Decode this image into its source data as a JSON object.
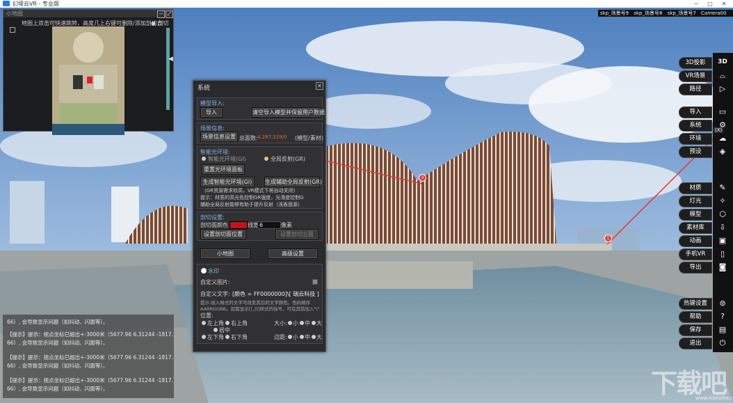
{
  "window": {
    "app_title": "幻境云VR - 专业版",
    "controls": [
      "−",
      "□",
      "✕"
    ]
  },
  "scene_tabs": {
    "items": [
      "skp_场景号9",
      "skp_场景号8",
      "skp_场景号7",
      "Camera00"
    ],
    "add_label": "+"
  },
  "minimap": {
    "title": "小地图",
    "hint": "地图上双击可快速跳转，高度几上右键可删除/添加剖切点",
    "cut_point_label": "剖切",
    "expand_arrow": "◀"
  },
  "log": {
    "lines": [
      "66）, 会导致显示问题（如抖动、闪面等）。",
      "【提示】提示：视点坐标已超出+-3000米（5677.96 6.31244 -1817.",
      "66）, 会导致显示问题（如抖动、闪面等）。",
      "【提示】提示：视点坐标已超出+-3000米（5677.96 6.31244 -1817.",
      "66）, 会导致显示问题（如抖动、闪面等）。",
      "【提示】提示：视点坐标已超出+-3000米（5677.96 6.31244 -1817.",
      "66）, 会导致显示问题（如抖动、闪面等）。"
    ]
  },
  "system_dialog": {
    "title": "系统",
    "close_label": "✕",
    "model_import": {
      "header": "模型导入:",
      "import_button": "导入",
      "clear_import_button": "清空导入模型并保留用户数据"
    },
    "scene_info": {
      "header": "场景信息:",
      "settings_button": "场景信息设置",
      "face_count_label": "总面数:",
      "face_count_value": "4,287,319/0",
      "model_material_label": "(模型/素材)"
    },
    "smart_lighting": {
      "header": "智能光环境:",
      "gi_env_label": "智能光环境(GI)",
      "global_reflection_label": "全局反射(GR)",
      "reset_env_button": "重置光环境面板",
      "generate_gi_button": "生成智能光环境(GI)",
      "generate_gr_button": "生成辅助全局反射(GR)",
      "note1": "(GR资源需求较高，VR模式下将自动关闭)",
      "note2": "提示：材质的高光色控制GR强度，光滑度控制G",
      "note3": "辅助全局反射能够有助于提升反射（浅表面源）"
    },
    "section_cut": {
      "header": "剖切设置:",
      "color_label": "剖切面颜色",
      "line_width_label": "线宽",
      "line_width_value": "6",
      "pixel_label": "像素",
      "set_position_button": "设置剖切面位置",
      "set_elevation_button": "设置剖切立面"
    },
    "minimap_button": "小地图",
    "advanced_button": "高级设置",
    "watermark": {
      "toggle_label": "水印",
      "custom_image_label": "自定义图片:",
      "custom_text_label": "自定义文字:",
      "custom_text_value": "[颜色 = FF0000000]\\[ 瑞云科技 ]",
      "tip1": "提示:插入格式的文字可改变其后的文字颜色。色码顺序",
      "tip2": "AARRGGBB。如需显示[]，][]样式的括号，可在其前加入\"\\\"",
      "position_label": "位置:",
      "positions": [
        "左上角",
        "右上角",
        "居中",
        "左下角",
        "右下角"
      ],
      "size_label": "大小:",
      "margin_label": "边距:",
      "size_options": [
        "小",
        "中",
        "大"
      ]
    }
  },
  "right_toolbar": {
    "items": [
      {
        "label": "3D投影",
        "icon": "3D"
      },
      {
        "label": "VR场景",
        "icon": "vr-headset-icon"
      },
      {
        "label": "路径",
        "icon": "play-icon"
      },
      {
        "label": "导入",
        "icon": "folder-icon"
      },
      {
        "label": "系统",
        "icon": "settings-icon"
      },
      {
        "label": "环境",
        "icon": "cloud-icon"
      },
      {
        "label": "预设",
        "icon": "layers-icon"
      },
      {
        "label": "材质",
        "icon": "brush-icon"
      },
      {
        "label": "灯光",
        "icon": "bulb-icon"
      },
      {
        "label": "模型",
        "icon": "cube-icon"
      },
      {
        "label": "素材库",
        "icon": "download-icon"
      },
      {
        "label": "动画",
        "icon": "camera-icon"
      },
      {
        "label": "手机VR",
        "icon": "phone-icon"
      },
      {
        "label": "导出",
        "icon": "export-icon"
      },
      {
        "label": "热键设置",
        "icon": "keyboard-icon"
      },
      {
        "label": "帮助",
        "icon": "help-icon"
      },
      {
        "label": "保存",
        "icon": "save-icon"
      },
      {
        "label": "退出",
        "icon": "power-icon"
      }
    ]
  },
  "markers": {
    "first": "1",
    "second": "2"
  },
  "system_tooltip": "(X)",
  "watermark_brand": {
    "text": "下载吧",
    "url": "www.xiazaiba.com"
  },
  "colors": {
    "accent": "#7fb3e6",
    "section_color": "#c0141b",
    "marker": "#e63b2e"
  }
}
